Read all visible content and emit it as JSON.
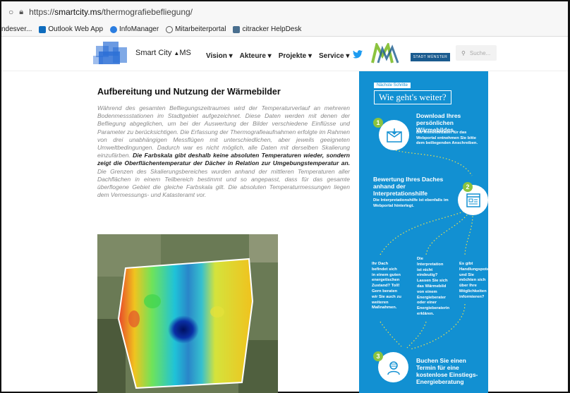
{
  "browser": {
    "url_prefix": "https://",
    "url_host": "smartcity.ms",
    "url_path": "/thermografiebefliegung/",
    "bookmarks": [
      "ndesver...",
      "Outlook Web App",
      "InfoManager",
      "Mitarbeiterportal",
      "citracker HelpDesk"
    ]
  },
  "header": {
    "brand": "Smart City",
    "brand_suffix": "MS",
    "nav": [
      "Vision",
      "Akteure",
      "Projekte",
      "Service"
    ],
    "stadt_logo": "STADT MÜNSTER",
    "search_placeholder": "Suche..."
  },
  "article": {
    "title": "Aufbereitung und Nutzung der Wärmebilder",
    "p1": "Während des gesamten Befliegungszeitraumes wird der Temperaturverlauf an mehreren Bodenmessstationen im Stadtgebiet aufgezeichnet. Diese Daten werden mit denen der Befliegung abgeglichen, um bei der Auswertung der Bilder verschiedene Einflüsse und Parameter zu berücksichtigen. Die Erfassung der Thermografieaufnahmen erfolgte im Rahmen von drei unabhängigen Messflügen mit unterschiedlichen, aber jeweils geeigneten Umweltbedingungen. Dadurch war es nicht möglich, alle Daten mit derselben Skalierung einzufärben. ",
    "p1_bold": "Die Farbskala gibt deshalb keine absoluten Temperaturen wieder, sondern zeigt die Oberflächentemperatur der Dächer in Relation zur Umgebungstemperatur an.",
    "p1_end": " Die Grenzen des Skalierungsbereiches wurden anhand der mittleren Temperaturen aller Dachflächen in einem Teilbereich bestimmt und so angepasst, dass für das gesamte überflogene Gebiet die gleiche Farbskala gilt. Die absoluten Temperaturmessungen liegen dem Vermessungs- und Katasteramt vor."
  },
  "panel": {
    "tag": "Nächste Schritte",
    "title": "Wie geht's weiter?",
    "step1_num": "1",
    "step1_title": "Download Ihres persönlichen Wärmebildes",
    "step1_text": "Die Anmeldedaten für das Webportal entnehmen Sie bitte dem beiliegenden Anschreiben.",
    "step2_num": "2",
    "step2_title": "Bewertung Ihres Daches anhand der Interpretationshilfe",
    "step2_text": "Die Interpretationshilfe ist ebenfalls im Webportal hinterlegt.",
    "col1": "Ihr Dach befindet sich in einem guten energetischen Zustand? Toll! Gern beraten wir Sie auch zu weiteren Maßnahmen.",
    "col2": "Die Interpretation ist nicht eindeutig? Lassen Sie sich das Wärmebild von einem Energieberater oder einer Energieberaterin erklären.",
    "col3": "Es gibt Handlungspotenzial und Sie möchten sich über Ihre Möglichkeiten informieren?",
    "step3_num": "3",
    "step3_title": "Buchen Sie einen Termin für eine kostenlose Einstiegs-Energieberatung"
  },
  "colors": {
    "panel_blue": "#1290d2",
    "accent_green": "#8bc33f",
    "brand_blue": "#2c6fd6"
  }
}
